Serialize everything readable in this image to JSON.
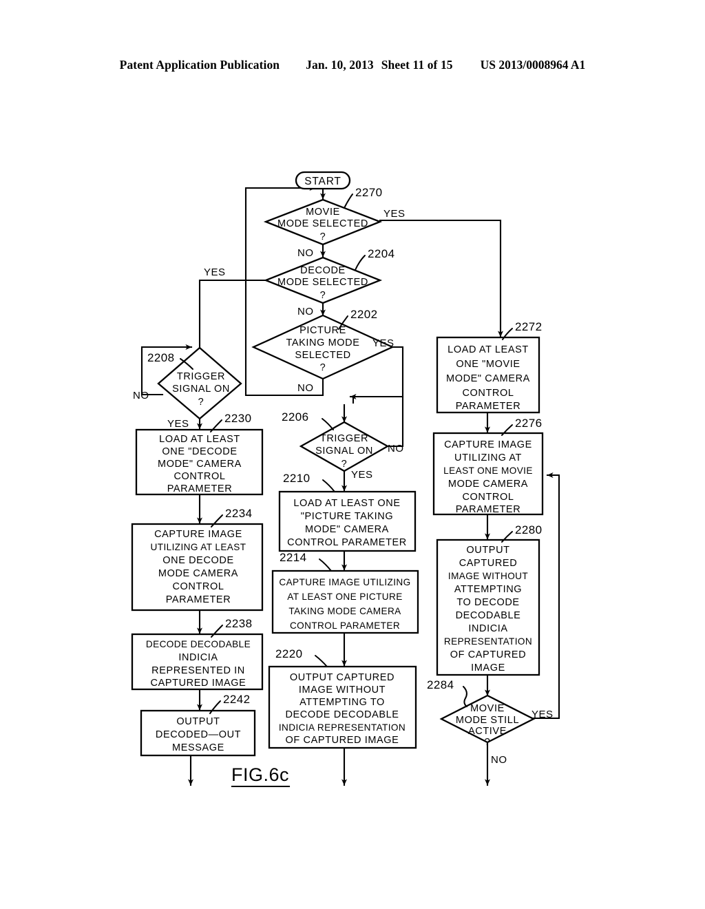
{
  "header": {
    "publication": "Patent Application Publication",
    "date": "Jan. 10, 2013",
    "sheet": "Sheet 11 of 15",
    "number": "US 2013/0008964 A1"
  },
  "figure": {
    "label": "FIG.6c",
    "start_label": "START"
  },
  "branch_labels": {
    "yes": "YES",
    "no": "NO"
  },
  "nodes": {
    "n2270": {
      "ref": "2270",
      "type": "decision",
      "lines": [
        "MOVIE",
        "MODE  SELECTED",
        "?"
      ],
      "yes": "YES",
      "no": "NO"
    },
    "n2204": {
      "ref": "2204",
      "type": "decision",
      "lines": [
        "DECODE",
        "MODE  SELECTED",
        "?"
      ],
      "yes": "YES",
      "no": "NO"
    },
    "n2202": {
      "ref": "2202",
      "type": "decision",
      "lines": [
        "PICTURE",
        "TAKING  MODE",
        "SELECTED",
        "?"
      ],
      "yes": "YES",
      "no": "NO"
    },
    "n2208": {
      "ref": "2208",
      "type": "decision",
      "lines": [
        "TRIGGER",
        "SIGNAL  ON",
        "?"
      ],
      "yes": "YES",
      "no": "NO"
    },
    "n2206": {
      "ref": "2206",
      "type": "decision",
      "lines": [
        "TRIGGER",
        "SIGNAL  ON",
        "?"
      ],
      "yes": "YES",
      "no": "NO"
    },
    "n2284": {
      "ref": "2284",
      "type": "decision",
      "lines": [
        "MOVIE",
        "MODE  STILL",
        "ACTIVE",
        "?"
      ],
      "yes": "YES",
      "no": "NO"
    },
    "n2230": {
      "ref": "2230",
      "type": "process",
      "lines": [
        "LOAD  AT  LEAST",
        "ONE  \"DECODE",
        "MODE\"  CAMERA",
        "CONTROL",
        "PARAMETER"
      ]
    },
    "n2234": {
      "ref": "2234",
      "type": "process",
      "lines": [
        "CAPTURE  IMAGE",
        "UTILIZING AT LEAST",
        "ONE  DECODE",
        "MODE  CAMERA",
        "CONTROL",
        "PARAMETER"
      ]
    },
    "n2238": {
      "ref": "2238",
      "type": "process",
      "lines": [
        "DECODE  DECODABLE",
        "INDICIA",
        "REPRESENTED  IN",
        "CAPTURED  IMAGE"
      ]
    },
    "n2242": {
      "ref": "2242",
      "type": "process",
      "lines": [
        "OUTPUT",
        "DECODED—OUT",
        "MESSAGE"
      ]
    },
    "n2210": {
      "ref": "2210",
      "type": "process",
      "lines": [
        "LOAD  AT  LEAST  ONE",
        "\"PICTURE  TAKING",
        "MODE\"  CAMERA",
        "CONTROL  PARAMETER"
      ]
    },
    "n2214": {
      "ref": "2214",
      "type": "process",
      "lines": [
        "CAPTURE  IMAGE  UTILIZING",
        "AT  LEAST  ONE  PICTURE",
        "TAKING  MODE  CAMERA",
        "CONTROL  PARAMETER"
      ]
    },
    "n2220": {
      "ref": "2220",
      "type": "process",
      "lines": [
        "OUTPUT  CAPTURED",
        "IMAGE  WITHOUT",
        "ATTEMPTING  TO",
        "DECODE  DECODABLE",
        "INDICIA  REPRESENTATION",
        "OF  CAPTURED  IMAGE"
      ]
    },
    "n2272": {
      "ref": "2272",
      "type": "process",
      "lines": [
        "LOAD  AT  LEAST",
        "ONE  \"MOVIE",
        "MODE\"  CAMERA",
        "CONTROL",
        "PARAMETER"
      ]
    },
    "n2276": {
      "ref": "2276",
      "type": "process",
      "lines": [
        "CAPTURE  IMAGE",
        "UTILIZING  AT",
        "LEAST  ONE  MOVIE",
        "MODE  CAMERA",
        "CONTROL",
        "PARAMETER"
      ]
    },
    "n2280": {
      "ref": "2280",
      "type": "process",
      "lines": [
        "OUTPUT",
        "CAPTURED",
        "IMAGE  WITHOUT",
        "ATTEMPTING",
        "TO  DECODE",
        "DECODABLE",
        "INDICIA",
        "REPRESENTATION",
        "OF  CAPTURED",
        "IMAGE"
      ]
    }
  },
  "colors": {
    "ink": "#000000",
    "paper": "#ffffff"
  }
}
